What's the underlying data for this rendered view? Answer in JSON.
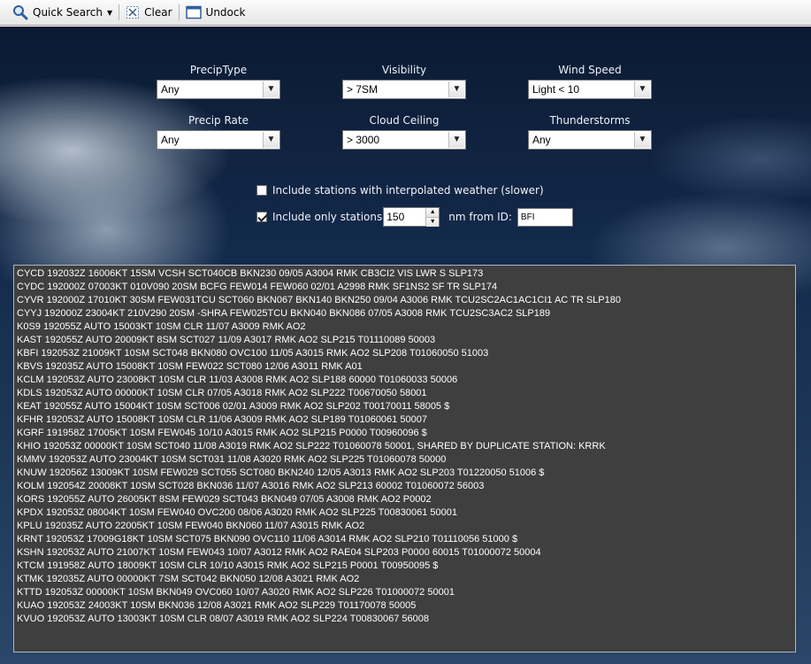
{
  "toolbar": {
    "quick_search_label": "Quick Search",
    "clear_label": "Clear",
    "undock_label": "Undock"
  },
  "filters": [
    {
      "label": "PrecipType",
      "value": "Any"
    },
    {
      "label": "Visibility",
      "value": "> 7SM"
    },
    {
      "label": "Wind Speed",
      "value": "Light < 10"
    },
    {
      "label": "Precip Rate",
      "value": "Any"
    },
    {
      "label": "Cloud Ceiling",
      "value": "> 3000"
    },
    {
      "label": "Thunderstorms",
      "value": "Any"
    }
  ],
  "options": {
    "interpolated_label": "Include stations with interpolated weather (slower)",
    "interpolated_checked": false,
    "only_stations_label": "Include only stations",
    "only_stations_checked": true,
    "distance_value": "150",
    "nm_from_label": "nm from ID:",
    "station_id": "BFI"
  },
  "results": [
    "CYCD 192032Z 16006KT 15SM VCSH SCT040CB BKN230 09/05 A3004 RMK CB3CI2 VIS LWR S SLP173",
    "CYDC 192000Z 07003KT 010V090 20SM BCFG FEW014 FEW060 02/01 A2998 RMK SF1NS2 SF TR SLP174",
    "CYVR 192000Z 17010KT 30SM FEW031TCU SCT060 BKN067 BKN140 BKN250 09/04 A3006 RMK TCU2SC2AC1AC1CI1 AC TR SLP180",
    "CYYJ 192000Z 23004KT 210V290 20SM -SHRA FEW025TCU BKN040 BKN086 07/05 A3008 RMK TCU2SC3AC2 SLP189",
    "K0S9 192055Z AUTO 15003KT 10SM CLR 11/07 A3009 RMK AO2",
    "KAST 192055Z AUTO 20009KT 8SM SCT027 11/09 A3017 RMK AO2 SLP215 T01110089 50003",
    "KBFI 192053Z 21009KT 10SM SCT048 BKN080 OVC100 11/05 A3015 RMK AO2 SLP208 T01060050 51003",
    "KBVS 192035Z AUTO 15008KT 10SM FEW022 SCT080 12/06 A3011 RMK A01",
    "KCLM 192053Z AUTO 23008KT 10SM CLR 11/03 A3008 RMK AO2 SLP188 60000 T01060033 50006",
    "KDLS 192053Z AUTO 00000KT 10SM CLR 07/05 A3018 RMK AO2 SLP222 T00670050 58001",
    "KEAT 192055Z AUTO 15004KT 10SM SCT006 02/01 A3009 RMK AO2 SLP202 T00170011 58005 $",
    "KFHR 192053Z AUTO 15008KT 10SM CLR 11/06 A3009 RMK AO2 SLP189 T01060061 50007",
    "KGRF 191958Z 17005KT 10SM FEW045 10/10 A3015 RMK AO2 SLP215 P0000 T00960096 $",
    "KHIO 192053Z 00000KT 10SM SCT040 11/08 A3019 RMK AO2 SLP222 T01060078 50001, SHARED BY DUPLICATE STATION: KRRK",
    "KMMV 192053Z AUTO 23004KT 10SM SCT031 11/08 A3020 RMK AO2 SLP225 T01060078 50000",
    "KNUW 192056Z 13009KT 10SM FEW029 SCT055 SCT080 BKN240 12/05 A3013 RMK AO2 SLP203 T01220050 51006 $",
    "KOLM 192054Z 20008KT 10SM SCT028 BKN036 11/07 A3016 RMK AO2 SLP213 60002 T01060072 56003",
    "KORS 192055Z AUTO 26005KT 8SM FEW029 SCT043 BKN049 07/05 A3008 RMK AO2 P0002",
    "KPDX 192053Z 08004KT 10SM FEW040 OVC200 08/06 A3020 RMK AO2 SLP225 T00830061 50001",
    "KPLU 192035Z AUTO 22005KT 10SM FEW040 BKN060 11/07 A3015 RMK AO2",
    "KRNT 192053Z 17009G18KT 10SM SCT075 BKN090 OVC110 11/06 A3014 RMK AO2 SLP210 T01110056 51000 $",
    "KSHN 192053Z AUTO 21007KT 10SM FEW043 10/07 A3012 RMK AO2 RAE04 SLP203 P0000 60015 T01000072 50004",
    "KTCM 191958Z AUTO 18009KT 10SM CLR 10/10 A3015 RMK AO2 SLP215 P0001 T00950095 $",
    "KTMK 192035Z AUTO 00000KT 7SM SCT042 BKN050 12/08 A3021 RMK AO2",
    "KTTD 192053Z 00000KT 10SM BKN049 OVC060 10/07 A3020 RMK AO2 SLP226 T01000072 50001",
    "KUAO 192053Z 24003KT 10SM BKN036 12/08 A3021 RMK AO2 SLP229 T01170078 50005",
    "KVUO 192053Z AUTO 13003KT 10SM CLR 08/07 A3019 RMK AO2 SLP224 T00830067 56008"
  ]
}
